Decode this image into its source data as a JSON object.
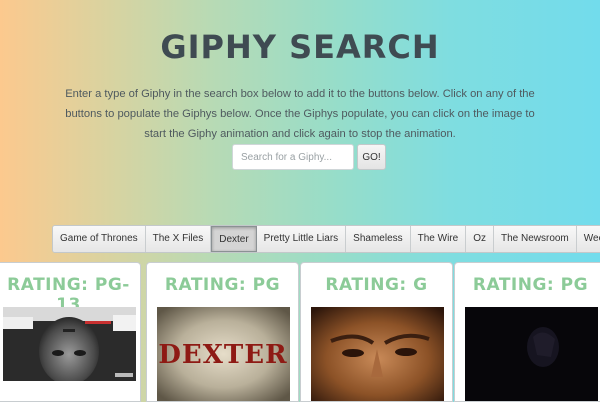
{
  "header": {
    "title": "Giphy Search",
    "intro": "Enter a type of Giphy in the search box below to add it to the buttons below. Click on any of the buttons to populate the Giphys below. Once the Giphys populate, you can click on the image to start the Giphy animation and click again to stop the animation."
  },
  "search": {
    "placeholder": "Search for a Giphy...",
    "value": "",
    "go_label": "GO!"
  },
  "topics": [
    {
      "label": "Game of Thrones",
      "active": false
    },
    {
      "label": "The X Files",
      "active": false
    },
    {
      "label": "Dexter",
      "active": true
    },
    {
      "label": "Pretty Little Liars",
      "active": false
    },
    {
      "label": "Shameless",
      "active": false
    },
    {
      "label": "The Wire",
      "active": false
    },
    {
      "label": "Oz",
      "active": false
    },
    {
      "label": "The Newsroom",
      "active": false
    },
    {
      "label": "Weeds",
      "active": false
    }
  ],
  "gifs": [
    {
      "rating_text": "Rating: PG-13",
      "image_desc_icon": "dexter-upside-down-image"
    },
    {
      "rating_text": "Rating: PG",
      "image_desc_icon": "dexter-title-image",
      "image_text": "DEXTER"
    },
    {
      "rating_text": "Rating: G",
      "image_desc_icon": "face-closeup-image"
    },
    {
      "rating_text": "Rating: PG",
      "image_desc_icon": "dark-scene-image"
    }
  ],
  "colors": {
    "gradient_left": "#fcc98e",
    "gradient_right": "#72dcec",
    "title": "#3f4b52",
    "rating": "#8ccb98"
  }
}
